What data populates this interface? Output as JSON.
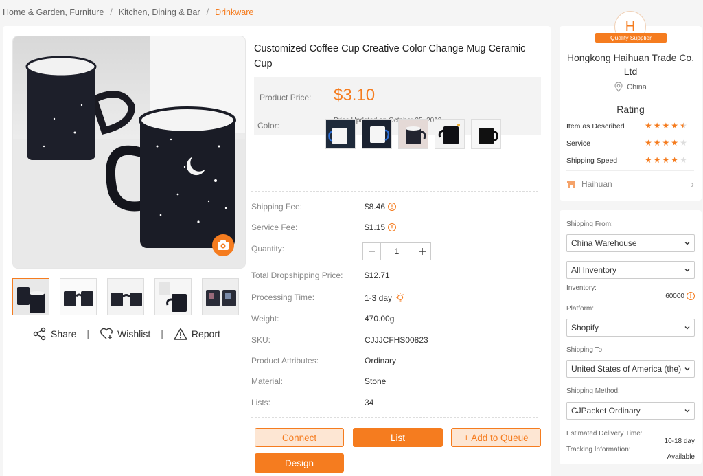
{
  "breadcrumb": {
    "items": [
      "Home & Garden, Furniture",
      "Kitchen, Dining & Bar",
      "Drinkware"
    ],
    "separator": "/"
  },
  "product": {
    "title": "Customized Coffee Cup Creative Color Change Mug Ceramic Cup",
    "price_label": "Product Price:",
    "price": "$3.10",
    "price_updated": "Price Updated on October 25, 2019",
    "color_label": "Color:",
    "swatches": [
      "white-mug-blue-handle",
      "white-mug-blue-handle-2",
      "heart-handle-mug",
      "black-heart-mug",
      "black-mug"
    ]
  },
  "social": {
    "share": "Share",
    "wishlist": "Wishlist",
    "report": "Report",
    "divider": "|"
  },
  "details": {
    "shipping_fee_label": "Shipping Fee:",
    "shipping_fee": "$8.46",
    "service_fee_label": "Service Fee:",
    "service_fee": "$1.15",
    "quantity_label": "Quantity:",
    "quantity": "1",
    "total_label": "Total Dropshipping Price:",
    "total": "$12.71",
    "processing_label": "Processing Time:",
    "processing": "1-3 day",
    "weight_label": "Weight:",
    "weight": "470.00g",
    "sku_label": "SKU:",
    "sku": "CJJJCFHS00823",
    "attributes_label": "Product Attributes:",
    "attributes": "Ordinary",
    "material_label": "Material:",
    "material": "Stone",
    "lists_label": "Lists:",
    "lists": "34"
  },
  "actions": {
    "connect": "Connect",
    "list": "List",
    "add_queue": "+ Add to Queue",
    "design": "Design"
  },
  "supplier": {
    "logo_letter": "H",
    "badge": "Quality Supplier",
    "name": "Hongkong Haihuan Trade Co. Ltd",
    "location": "China",
    "rating_title": "Rating",
    "ratings": [
      {
        "label": "Item as Described",
        "stars": 4.5
      },
      {
        "label": "Service",
        "stars": 4
      },
      {
        "label": "Shipping Speed",
        "stars": 4
      }
    ],
    "shop": "Haihuan"
  },
  "shipping": {
    "from_label": "Shipping From:",
    "from": "China Warehouse",
    "inventory_select": "All Inventory",
    "inventory_label": "Inventory:",
    "inventory": "60000",
    "platform_label": "Platform:",
    "platform": "Shopify",
    "to_label": "Shipping To:",
    "to": "United States of America (the)",
    "method_label": "Shipping Method:",
    "method": "CJPacket Ordinary",
    "delivery_label": "Estimated Delivery Time:",
    "delivery": "10-18 day",
    "tracking_label": "Tracking Information:",
    "tracking": "Available"
  },
  "colors": {
    "accent": "#f57c1f",
    "accent_light": "#fde6d3"
  }
}
